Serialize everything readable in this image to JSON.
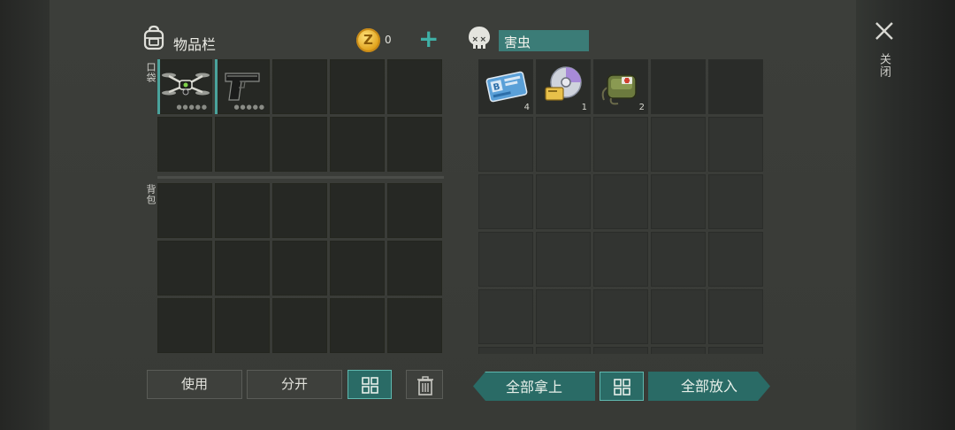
{
  "inventory": {
    "title": "物品栏",
    "coins": "0",
    "add_label": "+",
    "pocket_label": "口袋",
    "backpack_label": "背包",
    "pocket_slots": [
      {
        "icon": "drone-icon",
        "durability": "●●●●●"
      },
      {
        "icon": "pistol-icon",
        "durability": "●●●●●"
      },
      {
        "icon": ""
      },
      {
        "icon": ""
      },
      {
        "icon": ""
      },
      {
        "icon": ""
      },
      {
        "icon": ""
      },
      {
        "icon": ""
      },
      {
        "icon": ""
      },
      {
        "icon": ""
      }
    ]
  },
  "container": {
    "title": "害虫",
    "items": [
      {
        "icon": "keycard-icon",
        "count": "4"
      },
      {
        "icon": "disc-icon",
        "count": "1"
      },
      {
        "icon": "medical-bag-icon",
        "count": "2"
      }
    ]
  },
  "buttons": {
    "use": "使用",
    "split": "分开",
    "take_all": "全部拿上",
    "put_all": "全部放入"
  },
  "close_label": "关闭",
  "colors": {
    "accent": "#2a6b66",
    "accent_border": "#5fb8af",
    "panel": "#3a3c38",
    "slot": "#2a2c29"
  }
}
